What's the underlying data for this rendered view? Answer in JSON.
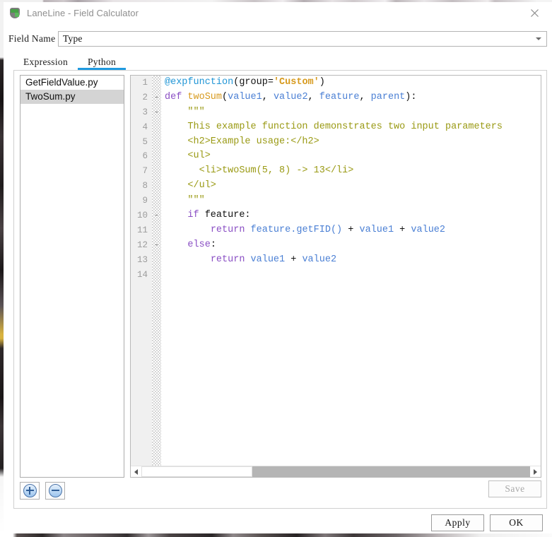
{
  "window": {
    "title": "LaneLine - Field Calculator",
    "app_icon": "qgis-shield-icon",
    "close_icon": "close-x-icon"
  },
  "field_row": {
    "label": "Field Name",
    "value": "Type",
    "dropdown_icon": "chevron-down-icon"
  },
  "tabs": [
    {
      "label": "Expression",
      "active": false
    },
    {
      "label": "Python",
      "active": true
    }
  ],
  "tab_accent_color": "#1f9ae0",
  "file_list": [
    {
      "name": "GetFieldValue.py",
      "selected": false
    },
    {
      "name": "TwoSum.py",
      "selected": true
    }
  ],
  "list_buttons": [
    {
      "name": "add-script-button",
      "icon": "plus-circle-icon"
    },
    {
      "name": "remove-script-button",
      "icon": "minus-circle-icon"
    }
  ],
  "editor": {
    "line_numbers": [
      "1",
      "2",
      "3",
      "4",
      "5",
      "6",
      "7",
      "8",
      "9",
      "10",
      "11",
      "12",
      "13",
      "14"
    ],
    "fold_markers": [
      "",
      "-",
      "-",
      "",
      "",
      "",
      "",
      "",
      "",
      "-",
      "",
      "-",
      "",
      ""
    ],
    "lines": [
      {
        "n": 1,
        "tokens": [
          {
            "t": "@expfunction",
            "c": "tok-decorator"
          },
          {
            "t": "(group=",
            "c": "tok-default"
          },
          {
            "t": "'Custom'",
            "c": "tok-string"
          },
          {
            "t": ")",
            "c": "tok-default"
          }
        ]
      },
      {
        "n": 2,
        "tokens": [
          {
            "t": "def ",
            "c": "tok-keyword"
          },
          {
            "t": "twoSum",
            "c": "tok-func"
          },
          {
            "t": "(",
            "c": "tok-default"
          },
          {
            "t": "value1",
            "c": "tok-param"
          },
          {
            "t": ", ",
            "c": "tok-default"
          },
          {
            "t": "value2",
            "c": "tok-param"
          },
          {
            "t": ", ",
            "c": "tok-default"
          },
          {
            "t": "feature",
            "c": "tok-param"
          },
          {
            "t": ", ",
            "c": "tok-default"
          },
          {
            "t": "parent",
            "c": "tok-param"
          },
          {
            "t": "):",
            "c": "tok-default"
          }
        ]
      },
      {
        "n": 3,
        "tokens": [
          {
            "t": "    \"\"\"",
            "c": "tok-doc"
          }
        ]
      },
      {
        "n": 4,
        "tokens": [
          {
            "t": "    This example function demonstrates two input parameters",
            "c": "tok-doc"
          }
        ]
      },
      {
        "n": 5,
        "tokens": [
          {
            "t": "    <h2>Example usage:</h2>",
            "c": "tok-doc"
          }
        ]
      },
      {
        "n": 6,
        "tokens": [
          {
            "t": "    <ul>",
            "c": "tok-doc"
          }
        ]
      },
      {
        "n": 7,
        "tokens": [
          {
            "t": "      <li>twoSum(5, 8) -> 13</li>",
            "c": "tok-doc"
          }
        ]
      },
      {
        "n": 8,
        "tokens": [
          {
            "t": "    </ul>",
            "c": "tok-doc"
          }
        ]
      },
      {
        "n": 9,
        "tokens": [
          {
            "t": "    \"\"\"",
            "c": "tok-doc"
          }
        ]
      },
      {
        "n": 10,
        "tokens": [
          {
            "t": "    ",
            "c": "tok-default"
          },
          {
            "t": "if",
            "c": "tok-keyword"
          },
          {
            "t": " feature:",
            "c": "tok-default"
          }
        ]
      },
      {
        "n": 11,
        "tokens": [
          {
            "t": "        ",
            "c": "tok-default"
          },
          {
            "t": "return",
            "c": "tok-keyword"
          },
          {
            "t": " ",
            "c": "tok-default"
          },
          {
            "t": "feature.getFID()",
            "c": "tok-ident"
          },
          {
            "t": " + ",
            "c": "tok-default"
          },
          {
            "t": "value1",
            "c": "tok-ident"
          },
          {
            "t": " + ",
            "c": "tok-default"
          },
          {
            "t": "value2",
            "c": "tok-ident"
          }
        ]
      },
      {
        "n": 12,
        "tokens": [
          {
            "t": "    ",
            "c": "tok-default"
          },
          {
            "t": "else",
            "c": "tok-keyword"
          },
          {
            "t": ":",
            "c": "tok-default"
          }
        ]
      },
      {
        "n": 13,
        "tokens": [
          {
            "t": "        ",
            "c": "tok-default"
          },
          {
            "t": "return",
            "c": "tok-keyword"
          },
          {
            "t": " ",
            "c": "tok-default"
          },
          {
            "t": "value1",
            "c": "tok-ident"
          },
          {
            "t": " + ",
            "c": "tok-default"
          },
          {
            "t": "value2",
            "c": "tok-ident"
          }
        ]
      },
      {
        "n": 14,
        "tokens": []
      }
    ],
    "scrollbar": {
      "left_arrow_icon": "arrow-left-icon",
      "right_arrow_icon": "arrow-right-icon"
    }
  },
  "save_button": {
    "label": "Save",
    "enabled": false
  },
  "footer": {
    "apply_label": "Apply",
    "ok_label": "OK"
  }
}
